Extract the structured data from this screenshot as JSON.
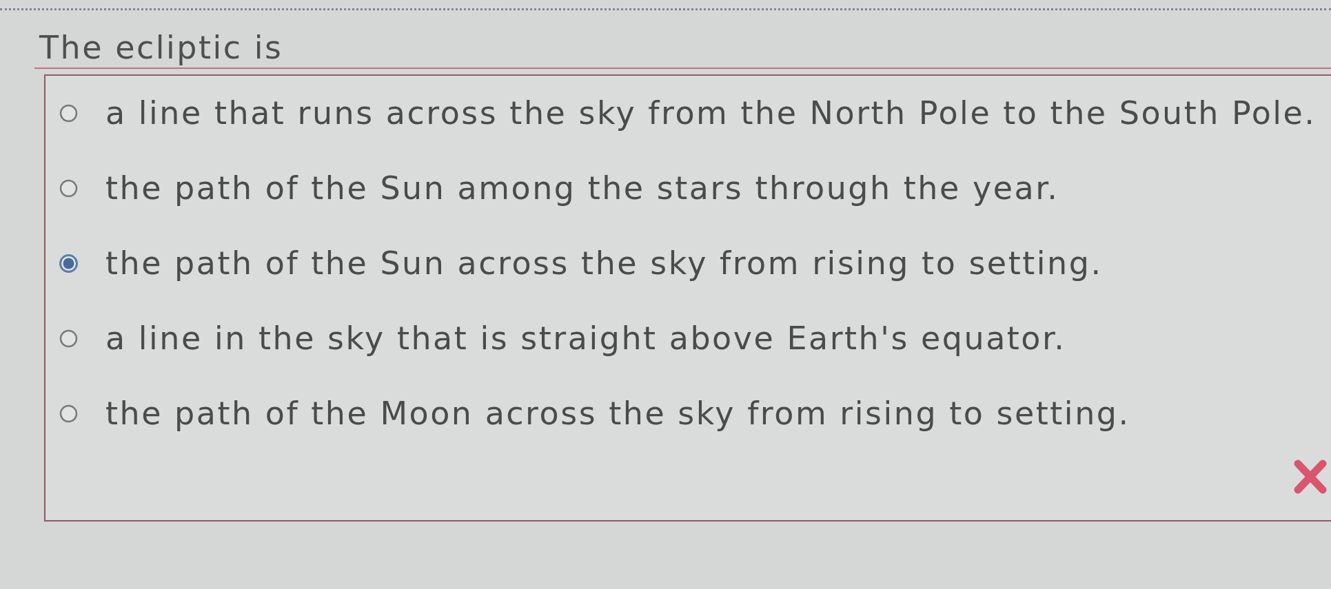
{
  "question": {
    "text": "The ecliptic is"
  },
  "options": [
    {
      "label": "a line that runs across the sky from the North Pole to the South Pole.",
      "selected": false
    },
    {
      "label": "the path of the Sun among the stars through the year.",
      "selected": false
    },
    {
      "label": "the path of the Sun across the sky from rising to setting.",
      "selected": true
    },
    {
      "label": "a line in the sky that is straight above Earth's equator.",
      "selected": false
    },
    {
      "label": "the path of the Moon across the sky from rising to setting.",
      "selected": false
    }
  ],
  "feedback": {
    "kind": "incorrect"
  }
}
